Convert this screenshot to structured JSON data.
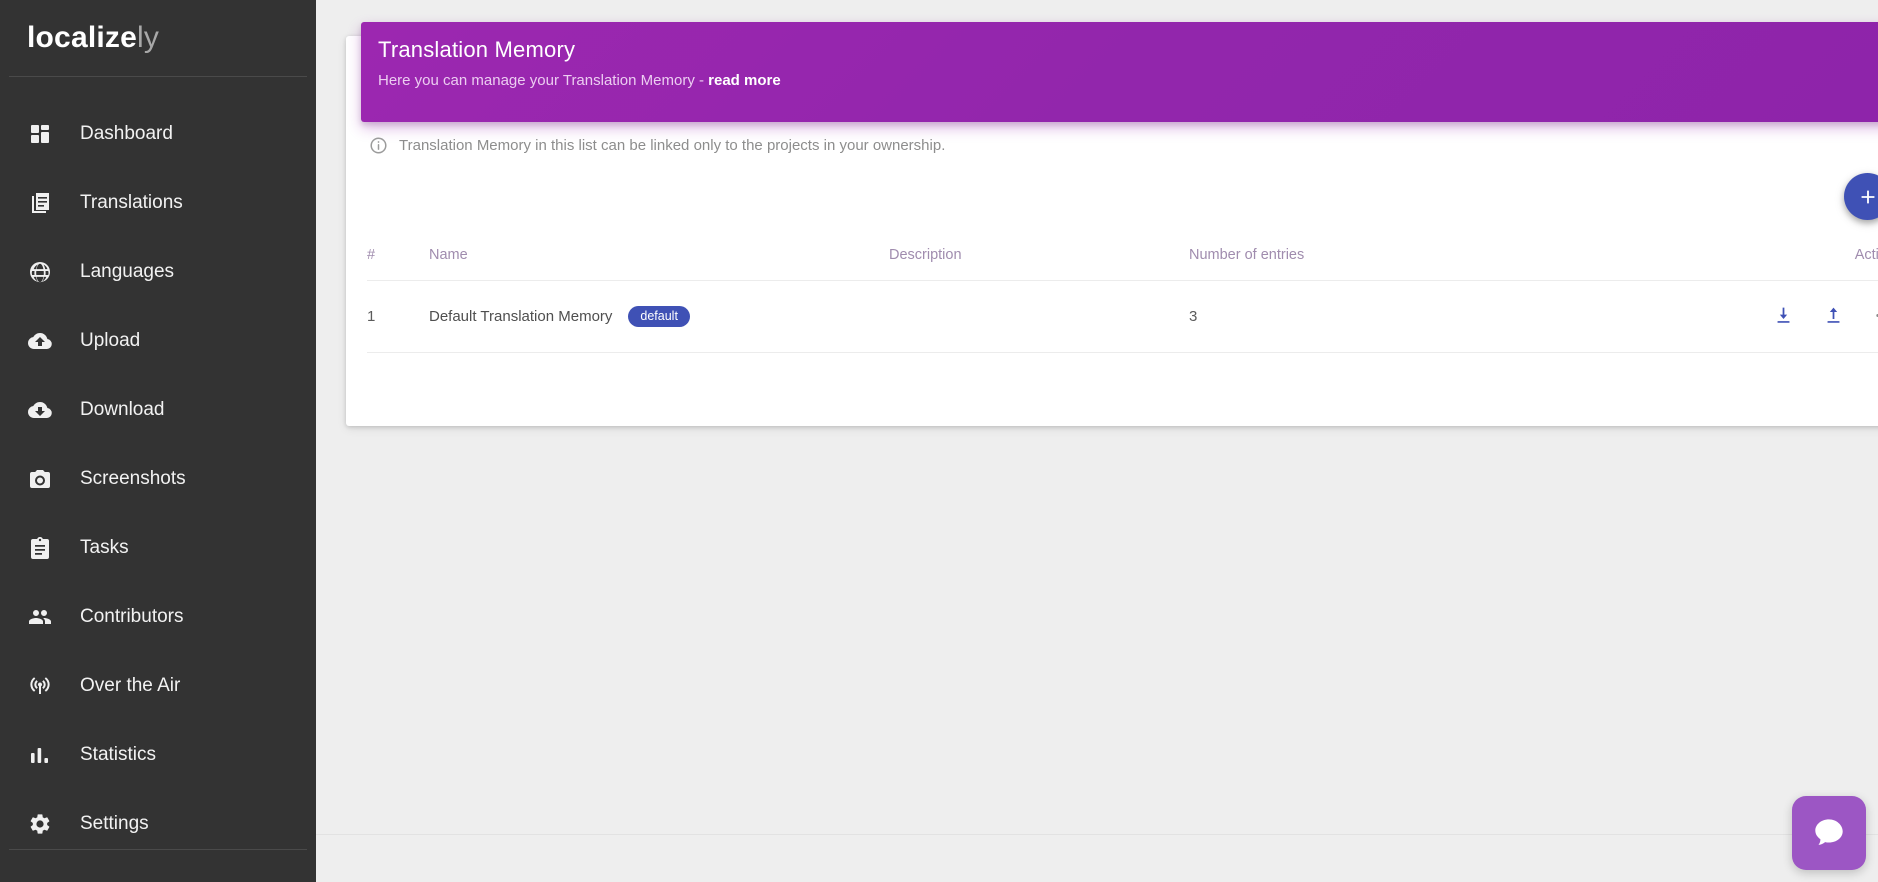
{
  "sidebar": {
    "brand": {
      "strong": "localize",
      "light": "ly"
    },
    "items": [
      {
        "label": "Dashboard",
        "icon": "dashboard-icon"
      },
      {
        "label": "Translations",
        "icon": "translations-icon"
      },
      {
        "label": "Languages",
        "icon": "globe-icon"
      },
      {
        "label": "Upload",
        "icon": "cloud-upload-icon"
      },
      {
        "label": "Download",
        "icon": "cloud-download-icon"
      },
      {
        "label": "Screenshots",
        "icon": "camera-icon"
      },
      {
        "label": "Tasks",
        "icon": "clipboard-icon"
      },
      {
        "label": "Contributors",
        "icon": "people-icon"
      },
      {
        "label": "Over the Air",
        "icon": "broadcast-icon"
      },
      {
        "label": "Statistics",
        "icon": "bar-chart-icon"
      },
      {
        "label": "Settings",
        "icon": "gear-icon"
      }
    ]
  },
  "banner": {
    "title": "Translation Memory",
    "subtitle_prefix": "Here you can manage your Translation Memory - ",
    "link_label": "read more",
    "color": "#9c27b0"
  },
  "info": {
    "icon": "info-circle-icon",
    "text": "Translation Memory in this list can be linked only to the projects in your ownership."
  },
  "add_button": {
    "icon": "plus-icon",
    "label": "",
    "color": "#3f51b5"
  },
  "table": {
    "columns": [
      "#",
      "Name",
      "Description",
      "Number of entries",
      "Action"
    ],
    "rows": [
      {
        "num": "1",
        "name": "Default Translation Memory",
        "badge": "default",
        "badge_color": "#3f51b5",
        "description": "",
        "entries": "3",
        "actions": [
          "download-icon",
          "upload-icon",
          "more-options-icon"
        ]
      }
    ]
  },
  "chat": {
    "icon": "chat-bubble-icon",
    "color": "#9c56c4"
  }
}
